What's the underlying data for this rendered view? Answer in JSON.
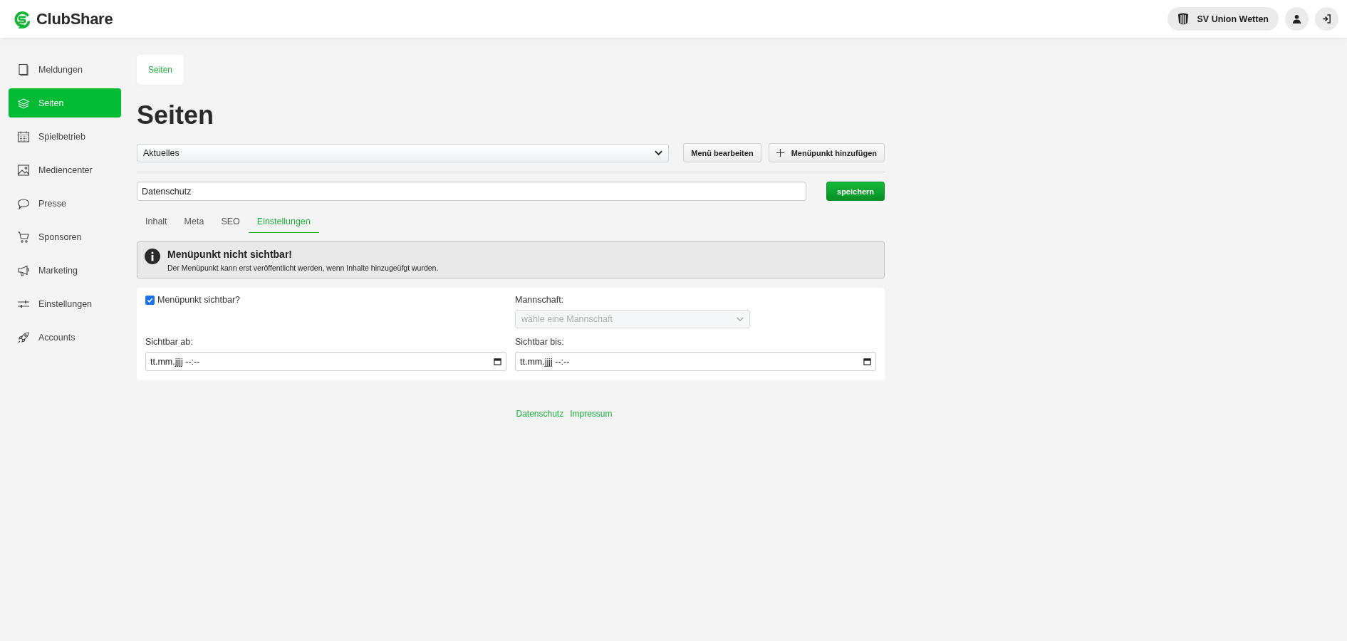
{
  "header": {
    "brand": "ClubShare",
    "club": "SV Union Wetten"
  },
  "sidebar": {
    "items": [
      {
        "label": "Meldungen",
        "selected": false
      },
      {
        "label": "Seiten",
        "selected": true
      },
      {
        "label": "Spielbetrieb",
        "selected": false
      },
      {
        "label": "Mediencenter",
        "selected": false
      },
      {
        "label": "Presse",
        "selected": false
      },
      {
        "label": "Sponsoren",
        "selected": false
      },
      {
        "label": "Marketing",
        "selected": false
      },
      {
        "label": "Einstellungen",
        "selected": false
      },
      {
        "label": "Accounts",
        "selected": false
      }
    ]
  },
  "breadcrumb": "Seiten",
  "title": "Seiten",
  "menu_select": {
    "value": "Aktuelles"
  },
  "buttons": {
    "edit_menu": "Menü bearbeiten",
    "add_item": "Menüpunkt hinzufügen",
    "save": "speichern"
  },
  "page_name": {
    "value": "Datenschutz"
  },
  "tabs": [
    {
      "label": "Inhalt",
      "selected": false
    },
    {
      "label": "Meta",
      "selected": false
    },
    {
      "label": "SEO",
      "selected": false
    },
    {
      "label": "Einstellungen",
      "selected": true
    }
  ],
  "alert": {
    "title": "Menüpunkt nicht sichtbar!",
    "text": "Der Menüpunkt kann erst veröffentlicht werden, wenn Inhalte hinzugeüfgt wurden."
  },
  "settings": {
    "visible": {
      "label": "Menüpunkt sichtbar?",
      "checked": true
    },
    "team": {
      "label": "Mannschaft:",
      "placeholder": "wähle eine Mannschaft",
      "disabled": true
    },
    "from": {
      "label": "Sichtbar ab:",
      "placeholder": "tt.mm.jjjj --:--"
    },
    "until": {
      "label": "Sichtbar bis:",
      "placeholder": "tt.mm.jjjj --:--"
    }
  },
  "footer": [
    "Datenschutz",
    "Impressum"
  ]
}
